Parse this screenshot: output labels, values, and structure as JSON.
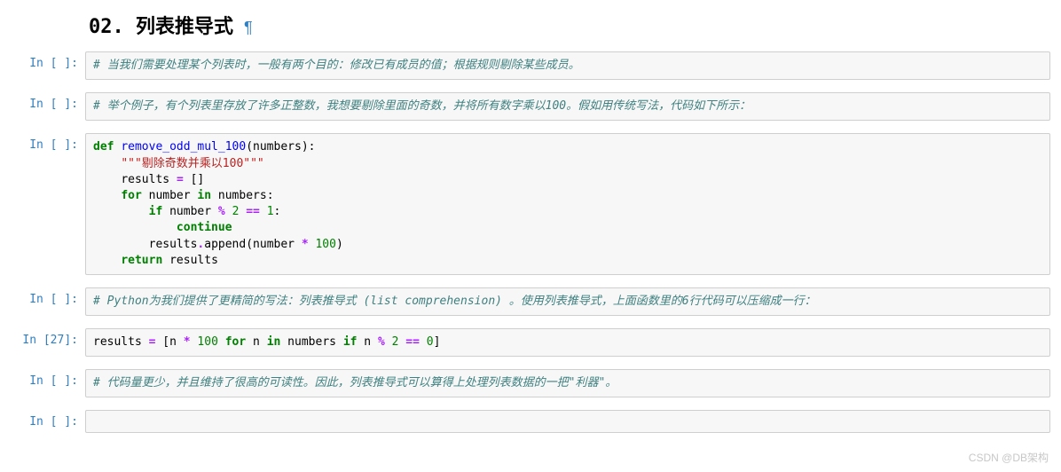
{
  "heading": {
    "title": "02. 列表推导式",
    "anchor": "¶"
  },
  "cells": [
    {
      "prompt": "In [ ]:",
      "type": "code",
      "code": {
        "comment": "# 当我们需要处理某个列表时，一般有两个目的：修改已有成员的值；根据规则剔除某些成员。"
      }
    },
    {
      "prompt": "In [ ]:",
      "type": "code",
      "code": {
        "comment": "# 举个例子，有个列表里存放了许多正整数，我想要剔除里面的奇数，并将所有数字乘以100。假如用传统写法，代码如下所示："
      }
    },
    {
      "prompt": "In [ ]:",
      "type": "code",
      "code": {
        "def": "def",
        "func": "remove_odd_mul_100",
        "params": "(numbers):",
        "doc": "\"\"\"剔除奇数并乘以100\"\"\"",
        "l1a": "results ",
        "l1b": "=",
        "l1c": " []",
        "l2a": "for",
        "l2b": " number ",
        "l2c": "in",
        "l2d": " numbers:",
        "l3a": "if",
        "l3b": " number ",
        "l3c": "%",
        "l3d": " ",
        "l3e": "2",
        "l3f": " ",
        "l3g": "==",
        "l3h": " ",
        "l3i": "1",
        "l3j": ":",
        "l4": "continue",
        "l5a": "results",
        "l5b": ".",
        "l5c": "append(number ",
        "l5d": "*",
        "l5e": " ",
        "l5f": "100",
        "l5g": ")",
        "l6a": "return",
        "l6b": " results"
      }
    },
    {
      "prompt": "In [ ]:",
      "type": "code",
      "code": {
        "comment": "# Python为我们提供了更精简的写法：列表推导式 (list comprehension) 。使用列表推导式，上面函数里的6行代码可以压缩成一行："
      }
    },
    {
      "prompt": "In [27]:",
      "type": "code",
      "code": {
        "a": "results ",
        "b": "=",
        "c": " [n ",
        "d": "*",
        "e": " ",
        "f": "100",
        "g": " ",
        "h": "for",
        "i": " n ",
        "j": "in",
        "k": " numbers ",
        "l": "if",
        "m": " n ",
        "n": "%",
        "o": " ",
        "p": "2",
        "q": " ",
        "r": "==",
        "s": " ",
        "t": "0",
        "u": "]"
      }
    },
    {
      "prompt": "In [ ]:",
      "type": "code",
      "code": {
        "comment": "# 代码量更少，并且维持了很高的可读性。因此，列表推导式可以算得上处理列表数据的一把\"利器\"。"
      }
    },
    {
      "prompt": "In [ ]:",
      "type": "code",
      "empty": true
    }
  ],
  "watermark": "CSDN @DB架构"
}
